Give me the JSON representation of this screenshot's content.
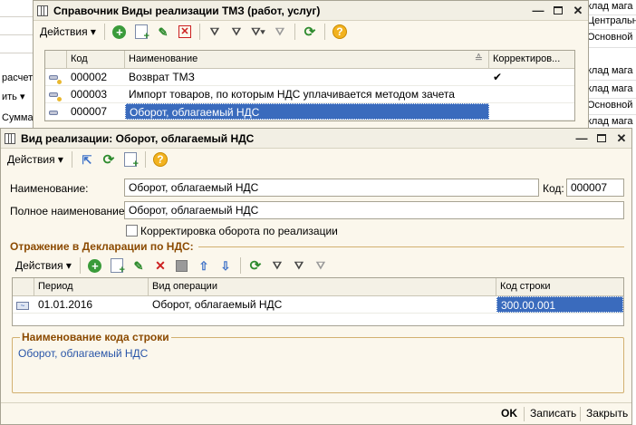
{
  "background": {
    "left_rows": [
      "",
      "",
      "",
      "расчет",
      "ить ▾",
      "Сумма"
    ],
    "right_rows": [
      "клад мага",
      "Центральн",
      "Основной с",
      "клад мага",
      "клад мага",
      "Основной с",
      "клад мага",
      "",
      "",
      "",
      "",
      "",
      "",
      "",
      "",
      "",
      "",
      "",
      "",
      "",
      ""
    ]
  },
  "list_window": {
    "title": "Справочник Виды реализации ТМЗ (работ, услуг)",
    "toolbar": {
      "actions": "Действия ▾"
    },
    "columns": [
      "Код",
      "Наименование",
      "Корректиров..."
    ],
    "rows": [
      {
        "code": "000002",
        "name": "Возврат ТМЗ",
        "corr": "✔"
      },
      {
        "code": "000003",
        "name": "Импорт товаров, по которым НДС уплачивается методом зачета",
        "corr": ""
      },
      {
        "code": "000007",
        "name": "Оборот, облагаемый НДС",
        "corr": ""
      }
    ]
  },
  "form_window": {
    "title": "Вид реализации: Оборот, облагаемый НДС",
    "toolbar": {
      "actions": "Действия ▾"
    },
    "name_label": "Наименование:",
    "name_value": "Оборот, облагаемый НДС",
    "code_label": "Код:",
    "code_value": "000007",
    "full_name_label": "Полное наименование:",
    "full_name_value": "Оборот, облагаемый НДС",
    "checkbox_label": "Корректировка оборота по реализации",
    "section_title": "Отражение в Декларации по НДС:",
    "sub_toolbar": {
      "actions": "Действия ▾"
    },
    "columns": [
      "Период",
      "Вид операции",
      "Код строки"
    ],
    "rows": [
      {
        "period": "01.01.2016",
        "operation": "Оборот, облагаемый НДС",
        "line_code": "300.00.001"
      }
    ],
    "group_title": "Наименование кода строки",
    "group_value": "Оборот, облагаемый НДС",
    "footer": {
      "ok": "OK",
      "save": "Записать",
      "close": "Закрыть"
    }
  }
}
